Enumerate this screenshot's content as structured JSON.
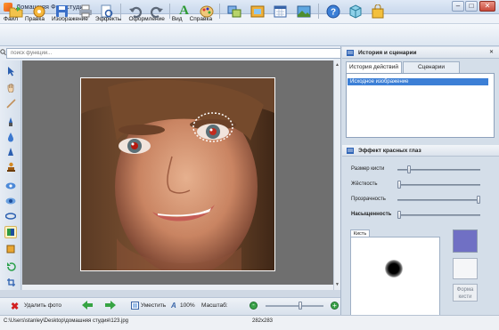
{
  "window": {
    "title": "Домашняя Фотостудия"
  },
  "menu": [
    "Файл",
    "Правка",
    "Изображение",
    "Эффекты",
    "Оформление",
    "Вид",
    "Справка"
  ],
  "search": {
    "placeholder": "поиск функций..."
  },
  "history_panel": {
    "title": "История и сценарии",
    "tabs": [
      {
        "label": "История действий",
        "active": true
      },
      {
        "label": "Сценарии",
        "active": false
      }
    ],
    "items": [
      "Исходное изображение"
    ]
  },
  "effect_panel": {
    "title": "Эффект красных глаз",
    "sliders": [
      {
        "label": "Размер кисти",
        "value": 0.12,
        "bold": false
      },
      {
        "label": "Жёсткость",
        "value": 0.0,
        "bold": false
      },
      {
        "label": "Прозрачность",
        "value": 1.0,
        "bold": false
      },
      {
        "label": "Насыщенность",
        "value": 0.0,
        "bold": true
      }
    ],
    "brush_tab": "Кисть",
    "brush_color": "#7070c4",
    "form_button": "Форма кисти"
  },
  "bottom": {
    "delete_label": "Удалить фото",
    "fit_label": "Уместить",
    "zoom_100": "100%",
    "scale_label": "Масштаб:",
    "zoom_slider": 0.6
  },
  "status": {
    "path": "C:\\Users\\stanley\\Desktop\\домашняя студия\\123.jpg",
    "size": "282x283"
  }
}
